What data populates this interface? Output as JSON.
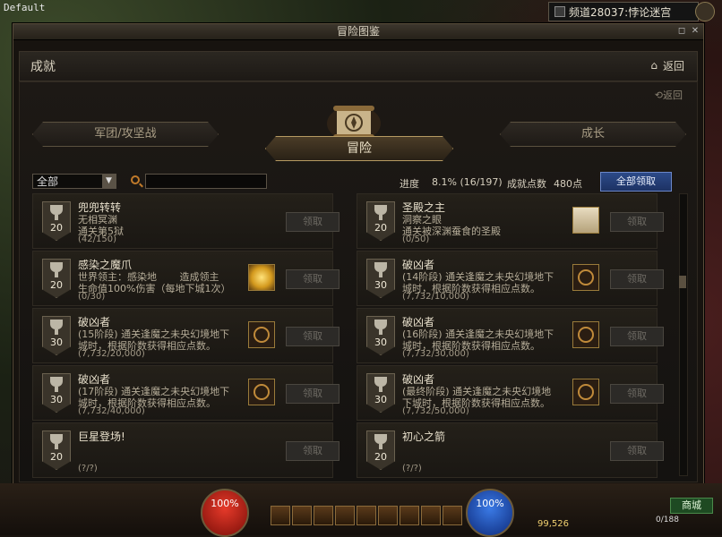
{
  "hud_top": {
    "default_label": "Default",
    "channel": "频道28037:悖论迷宫"
  },
  "window": {
    "title": "冒险图鉴",
    "header_title": "成就",
    "back_label": "返回",
    "back_label_2": "返回"
  },
  "categories": {
    "left": "军团/攻坚战",
    "center": "冒险",
    "right": "成长"
  },
  "toolbar": {
    "filter_value": "全部",
    "search_value": "",
    "progress_label": "进度",
    "progress_value": "8.1% (16/197)",
    "points_label": "成就点数",
    "points_value": "480点",
    "claim_all_label": "全部领取"
  },
  "achievements": [
    {
      "name": "兜兜转转",
      "desc1": "无相冥渊",
      "desc2": "通关第5狱",
      "progress": "(42/150)",
      "points": "20",
      "reward": "none",
      "claim": "领取"
    },
    {
      "name": "圣殿之主",
      "desc1": "洞察之眼",
      "desc2": "通关被深渊蚕食的圣殿",
      "progress": "(0/50)",
      "points": "20",
      "reward": "chest",
      "claim": "领取"
    },
    {
      "name": "感染之魔爪",
      "desc1": "世界领主：感染地 　　造成领主",
      "desc2": "生命值100%伤害（每地下城1次）",
      "progress": "(0/30)",
      "points": "20",
      "reward": "gold",
      "claim": "领取"
    },
    {
      "name": "破凶者",
      "desc1": "(14阶段) 通关逢魔之未央幻境地下",
      "desc2": "城时，根据阶数获得相应点数。",
      "progress": "(7,732/10,000)",
      "points": "30",
      "reward": "emblem",
      "claim": "领取"
    },
    {
      "name": "破凶者",
      "desc1": "(15阶段) 通关逢魔之未央幻境地下",
      "desc2": "城时，根据阶数获得相应点数。",
      "progress": "(7,732/20,000)",
      "points": "30",
      "reward": "emblem",
      "claim": "领取"
    },
    {
      "name": "破凶者",
      "desc1": "(16阶段) 通关逢魔之未央幻境地下",
      "desc2": "城时，根据阶数获得相应点数。",
      "progress": "(7,732/30,000)",
      "points": "30",
      "reward": "emblem",
      "claim": "领取"
    },
    {
      "name": "破凶者",
      "desc1": "(17阶段) 通关逢魔之未央幻境地下",
      "desc2": "城时，根据阶数获得相应点数。",
      "progress": "(7,732/40,000)",
      "points": "30",
      "reward": "emblem",
      "claim": "领取"
    },
    {
      "name": "破凶者",
      "desc1": "(最终阶段) 通关逢魔之未央幻境地",
      "desc2": "下城时，根据阶数获得相应点数。",
      "progress": "(7,732/50,000)",
      "points": "30",
      "reward": "emblem",
      "claim": "领取"
    },
    {
      "name": "巨星登场!",
      "desc1": "",
      "desc2": "",
      "progress": "(?/?)",
      "points": "20",
      "reward": "none",
      "claim": "领取"
    },
    {
      "name": "初心之箭",
      "desc1": "",
      "desc2": "",
      "progress": "(?/?)",
      "points": "20",
      "reward": "none",
      "claim": "领取"
    }
  ],
  "hud_bottom": {
    "hp_label": "100%",
    "mp_label": "100%",
    "gold": "99,526",
    "inventory": "0/188",
    "town_label": "商城"
  }
}
